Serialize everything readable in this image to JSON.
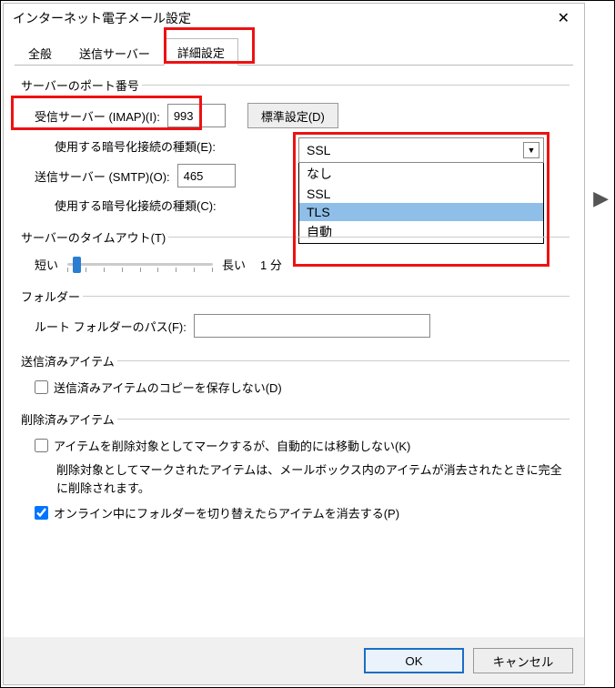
{
  "window": {
    "title": "インターネット電子メール設定"
  },
  "tabs": {
    "general": "全般",
    "outgoing": "送信サーバー",
    "advanced": "詳細設定"
  },
  "serverPorts": {
    "groupLabel": "サーバーのポート番号",
    "imapLabel": "受信サーバー (IMAP)(I):",
    "imapPort": "993",
    "defaultsBtn": "標準設定(D)",
    "encryptE": "使用する暗号化接続の種類(E):",
    "smtpLabel": "送信サーバー (SMTP)(O):",
    "smtpPort": "465",
    "encryptC": "使用する暗号化接続の種類(C):"
  },
  "dropdown": {
    "selected": "SSL",
    "options": [
      "なし",
      "SSL",
      "TLS",
      "自動"
    ],
    "highlightIndex": 2
  },
  "timeouts": {
    "groupLabel": "サーバーのタイムアウト(T)",
    "short": "短い",
    "long": "長い",
    "value": "1 分"
  },
  "folders": {
    "groupLabel": "フォルダー",
    "rootLabel": "ルート フォルダーのパス(F):",
    "rootValue": ""
  },
  "sentItems": {
    "groupLabel": "送信済みアイテム",
    "noSaveLabel": "送信済みアイテムのコピーを保存しない(D)",
    "noSaveChecked": false
  },
  "deletedItems": {
    "groupLabel": "削除済みアイテム",
    "markLabel": "アイテムを削除対象としてマークするが、自動的には移動しない(K)",
    "markChecked": false,
    "markDesc": "削除対象としてマークされたアイテムは、メールボックス内のアイテムが消去されたときに完全に削除されます。",
    "purgeLabel": "オンライン中にフォルダーを切り替えたらアイテムを消去する(P)",
    "purgeChecked": true
  },
  "buttons": {
    "ok": "OK",
    "cancel": "キャンセル"
  }
}
